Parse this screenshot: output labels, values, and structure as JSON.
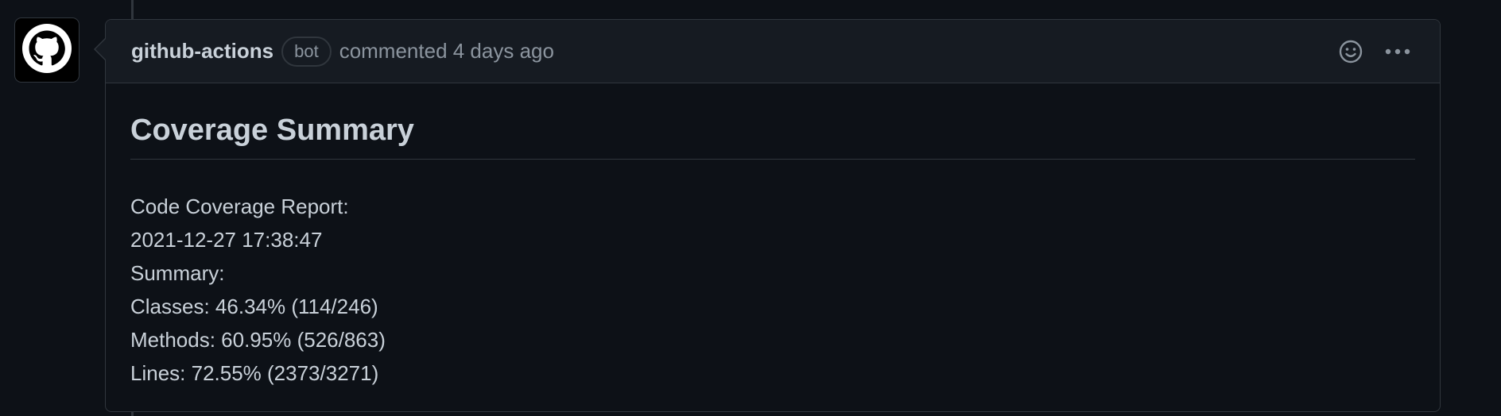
{
  "colors": {
    "background": "#0d1117",
    "header_bg": "#161b22",
    "border": "#30363d",
    "text": "#c9d1d9",
    "muted": "#8b949e"
  },
  "avatar": {
    "icon": "github-octocat-icon"
  },
  "comment": {
    "author": "github-actions",
    "badge": "bot",
    "meta": "commented 4 days ago",
    "actions": {
      "reaction_icon": "smiley-icon",
      "menu_icon": "kebab-horizontal-icon"
    },
    "title": "Coverage Summary",
    "lines": {
      "l1": "Code Coverage Report:",
      "l2": "2021-12-27 17:38:47",
      "l3": "Summary:",
      "l4": "Classes: 46.34% (114/246)",
      "l5": "Methods: 60.95% (526/863)",
      "l6": "Lines: 72.55% (2373/3271)"
    }
  }
}
